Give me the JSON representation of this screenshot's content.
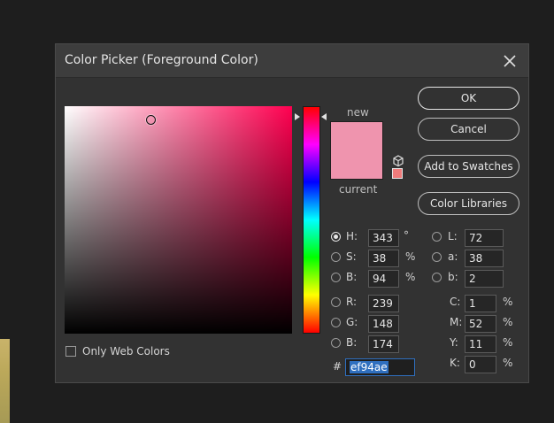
{
  "dialog": {
    "title": "Color Picker (Foreground Color)",
    "close_icon": "close-icon"
  },
  "preview": {
    "new_label": "new",
    "current_label": "current",
    "new_color": "#ef94ae",
    "current_color": "#ef94ae",
    "gamut_icon": "cube-icon",
    "gamut_swatch_color": "#f07b7b"
  },
  "buttons": {
    "ok": "OK",
    "cancel": "Cancel",
    "add_swatches": "Add to Swatches",
    "color_libraries": "Color Libraries"
  },
  "hsb": {
    "h": {
      "label": "H:",
      "value": "343",
      "unit": "°"
    },
    "s": {
      "label": "S:",
      "value": "38",
      "unit": "%"
    },
    "b": {
      "label": "B:",
      "value": "94",
      "unit": "%"
    }
  },
  "lab": {
    "l": {
      "label": "L:",
      "value": "72"
    },
    "a": {
      "label": "a:",
      "value": "38"
    },
    "b": {
      "label": "b:",
      "value": "2"
    }
  },
  "rgb": {
    "r": {
      "label": "R:",
      "value": "239"
    },
    "g": {
      "label": "G:",
      "value": "148"
    },
    "b": {
      "label": "B:",
      "value": "174"
    }
  },
  "cmyk": {
    "c": {
      "label": "C:",
      "value": "1",
      "unit": "%"
    },
    "m": {
      "label": "M:",
      "value": "52",
      "unit": "%"
    },
    "y": {
      "label": "Y:",
      "value": "11",
      "unit": "%"
    },
    "k": {
      "label": "K:",
      "value": "0",
      "unit": "%"
    }
  },
  "hex": {
    "label": "#",
    "value": "ef94ae"
  },
  "only_web_colors": {
    "label": "Only Web Colors",
    "checked": false
  },
  "selected_mode": "H",
  "colors": {
    "dialog_bg": "#323232",
    "titlebar_bg": "#3d3d3d",
    "selection": "#2f6fbf"
  }
}
